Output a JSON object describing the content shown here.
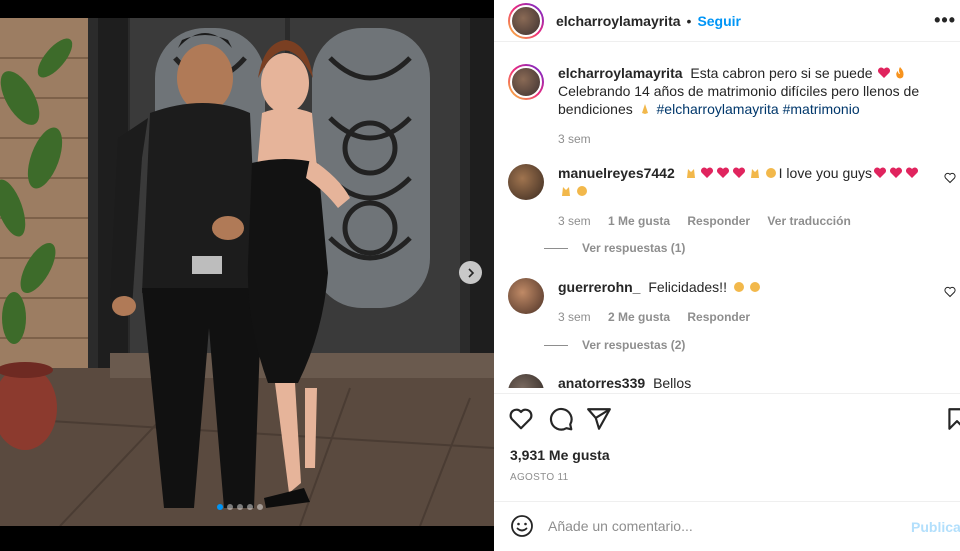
{
  "post": {
    "username": "elcharroylamayrita",
    "separator": "•",
    "follow_label": "Seguir",
    "more_label": "•••",
    "caption_text": "Esta cabron pero si se puede",
    "caption_line2": "Celebrando 14 años de matrimonio difíciles pero llenos de bendiciones",
    "hashtag1": "#elcharroylamayrita",
    "hashtag2": "#matrimonio",
    "caption_time": "3 sem",
    "likes": "3,931 Me gusta",
    "date": "AGOSTO 11"
  },
  "carousel": {
    "slides": 5,
    "active_index": 0
  },
  "comments": [
    {
      "user": "manuelreyes7442",
      "text": "I love you guys",
      "time": "3 sem",
      "likes": "1 Me gusta",
      "reply": "Responder",
      "translate": "Ver traducción",
      "replies": "Ver respuestas (1)"
    },
    {
      "user": "guerrerohn_",
      "text": "Felicidades!!",
      "time": "3 sem",
      "likes": "2 Me gusta",
      "reply": "Responder",
      "replies": "Ver respuestas (2)"
    },
    {
      "user": "anatorres339",
      "text": "Bellos"
    }
  ],
  "composer": {
    "placeholder": "Añade un comentario...",
    "post_label": "Publicar"
  },
  "colors": {
    "accent": "#0095f6",
    "heart_red": "#ed4956",
    "post_disabled": "#b2dffc"
  }
}
